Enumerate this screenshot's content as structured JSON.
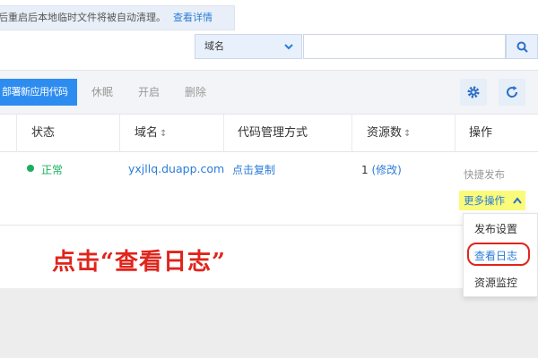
{
  "notice": {
    "message": "后重启后本地临时文件将被自动清理。",
    "link": "查看详情"
  },
  "search": {
    "select_value": "域名",
    "input_value": "",
    "input_placeholder": ""
  },
  "toolbar": {
    "primary_label": "部署新应用代码",
    "sleep_label": "休眠",
    "start_label": "开启",
    "delete_label": "删除"
  },
  "table": {
    "headers": {
      "status": "状态",
      "domain": "域名",
      "code_mgmt": "代码管理方式",
      "resources": "资源数",
      "actions": "操作"
    },
    "row": {
      "status": "正常",
      "domain": "yxjllq.duapp.com",
      "code_mgmt": "点击复制",
      "resources_count": "1",
      "resources_edit": "(修改)",
      "quick_publish": "快捷发布",
      "more_actions": "更多操作"
    }
  },
  "dropdown": {
    "items": [
      "发布设置",
      "查看日志",
      "资源监控"
    ]
  },
  "annotation": "点击“查看日志”",
  "colors": {
    "accent": "#2d8cf0",
    "link": "#2b7cd8",
    "success": "#1aaf5d",
    "annotation": "#e0241b",
    "highlight": "#fbfb7a"
  }
}
